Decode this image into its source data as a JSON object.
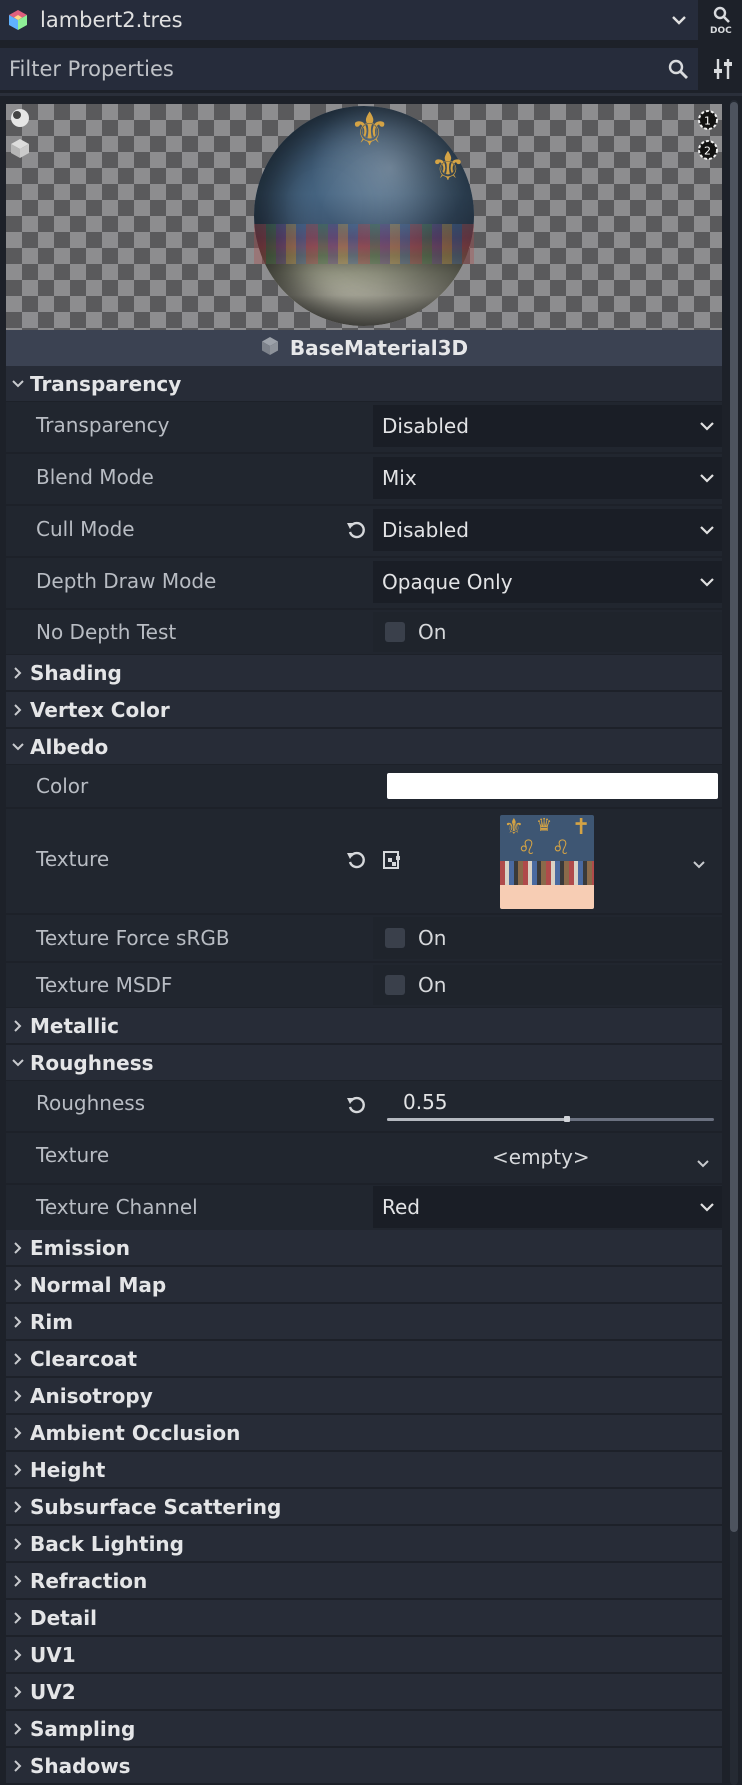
{
  "header": {
    "resource_name": "lambert2.tres",
    "filter_placeholder": "Filter Properties"
  },
  "preview": {
    "material_label": "BaseMaterial3D"
  },
  "sections": {
    "transparency": "Transparency",
    "shading": "Shading",
    "vertex_color": "Vertex Color",
    "albedo": "Albedo",
    "metallic": "Metallic",
    "roughness": "Roughness",
    "emission": "Emission",
    "normal_map": "Normal Map",
    "rim": "Rim",
    "clearcoat": "Clearcoat",
    "anisotropy": "Anisotropy",
    "ambient_occlusion": "Ambient Occlusion",
    "height": "Height",
    "subsurface_scattering": "Subsurface Scattering",
    "back_lighting": "Back Lighting",
    "refraction": "Refraction",
    "detail": "Detail",
    "uv1": "UV1",
    "uv2": "UV2",
    "sampling": "Sampling",
    "shadows": "Shadows"
  },
  "transparency": {
    "transparency_label": "Transparency",
    "transparency_value": "Disabled",
    "blend_mode_label": "Blend Mode",
    "blend_mode_value": "Mix",
    "cull_mode_label": "Cull Mode",
    "cull_mode_value": "Disabled",
    "depth_draw_label": "Depth Draw Mode",
    "depth_draw_value": "Opaque Only",
    "no_depth_test_label": "No Depth Test",
    "no_depth_test_check": "On",
    "no_depth_test_checked": false
  },
  "albedo": {
    "color_label": "Color",
    "color_value": "#ffffff",
    "texture_label": "Texture",
    "force_srgb_label": "Texture Force sRGB",
    "force_srgb_check": "On",
    "force_srgb_checked": false,
    "msdf_label": "Texture MSDF",
    "msdf_check": "On",
    "msdf_checked": false
  },
  "roughness": {
    "roughness_label": "Roughness",
    "roughness_value": "0.55",
    "roughness_fraction": 0.55,
    "texture_label": "Texture",
    "texture_value": "<empty>",
    "channel_label": "Texture Channel",
    "channel_value": "Red"
  },
  "colors": {
    "background": "#1d2129",
    "section_bg": "#272c37",
    "accent_gold": "#d4a345"
  }
}
